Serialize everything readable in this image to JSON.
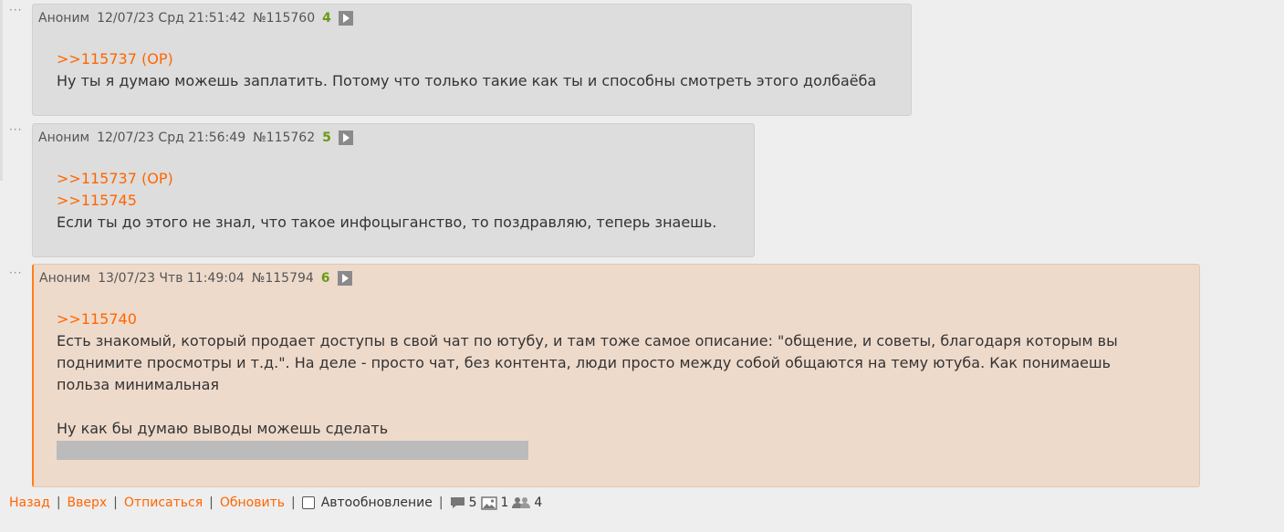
{
  "posts": [
    {
      "author": "Аноним",
      "date": "12/07/23 Срд 21:51:42",
      "number": "№115760",
      "index": "4",
      "links": [
        ">>115737 (OP)"
      ],
      "text": [
        "Ну ты я думаю можешь заплатить. Потому что только такие как ты и способны смотреть этого долбаёба"
      ]
    },
    {
      "author": "Аноним",
      "date": "12/07/23 Срд 21:56:49",
      "number": "№115762",
      "index": "5",
      "links": [
        ">>115737 (OP)",
        ">>115745"
      ],
      "text": [
        "Если ты до этого не знал, что такое инфоцыганство, то поздравляю, теперь знаешь."
      ]
    },
    {
      "author": "Аноним",
      "date": "13/07/23 Чтв 11:49:04",
      "number": "№115794",
      "index": "6",
      "links": [
        ">>115740"
      ],
      "text": [
        "Есть знакомый, который продает доступы в свой чат по ютубу, и там тоже самое описание: \"общение, и советы, благодаря которым вы",
        "поднимите просмотры и т.д.\". На деле - просто чат, без контента, люди просто между собой общаются на тему ютуба. Как понимаешь",
        "польза минимальная",
        "",
        "Ну как бы думаю выводы можешь сделать"
      ]
    }
  ],
  "footer": {
    "back": "Назад",
    "up": "Вверх",
    "unsubscribe": "Отписаться",
    "refresh": "Обновить",
    "autoupdate": "Автообновление",
    "posts_count": "5",
    "images_count": "1",
    "posters_count": "4"
  }
}
